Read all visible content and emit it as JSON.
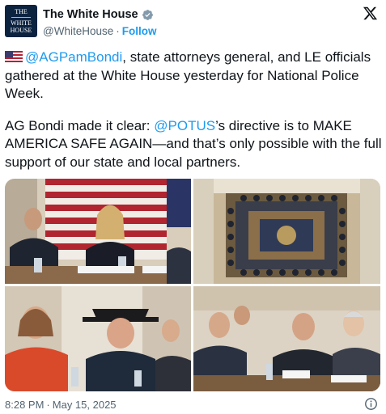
{
  "account": {
    "display_name": "The White House",
    "handle": "@WhiteHouse",
    "separator": "·",
    "follow_label": "Follow",
    "avatar_text_top": "THE",
    "avatar_text_mid": "WHITE",
    "avatar_text_bottom": "HOUSE"
  },
  "tweet": {
    "p1_mention": "@AGPamBondi",
    "p1_rest": ", state attorneys general, and LE officials gathered at the White House yesterday for National Police Week.",
    "p2_lead": "AG Bondi made it clear: ",
    "p2_mention": "@POTUS",
    "p2_rest": "’s directive is to MAKE AMERICA SAFE AGAIN—and that’s only possible with the full support of our state and local partners."
  },
  "footer": {
    "time": "8:28 PM",
    "separator": "·",
    "date": "May 15, 2025"
  },
  "icons": {
    "verified": "verified-badge-icon",
    "x_logo": "x-logo-icon",
    "flag": "us-flag-icon",
    "info": "info-icon"
  },
  "colors": {
    "link": "#1d9bf0",
    "secondary_text": "#536471",
    "avatar_bg": "#0c2340"
  }
}
